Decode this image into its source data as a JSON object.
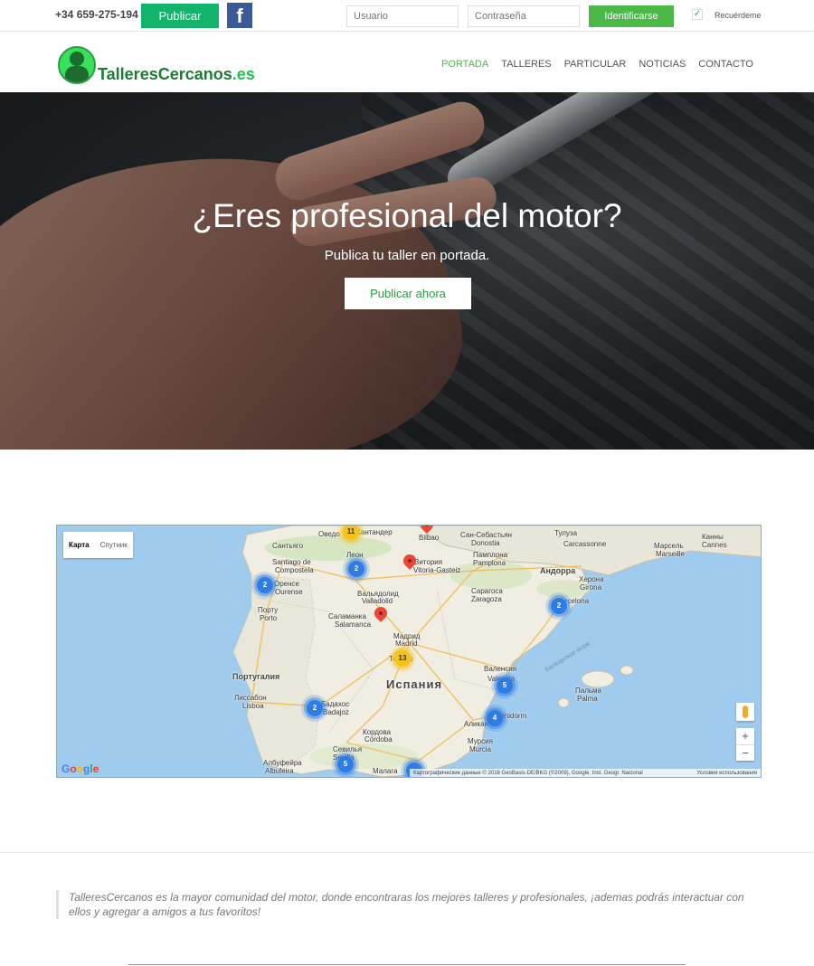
{
  "topbar": {
    "phone": "+34 659-275-194",
    "publish_label": "Publicar",
    "facebook_glyph": "f",
    "username_placeholder": "Usuario",
    "password_placeholder": "Contraseña",
    "login_label": "Identificarse",
    "remember_label": "Recuérdeme",
    "remember_checked": true
  },
  "brand": {
    "name_main": "TalleresCercanos",
    "name_domain": ".es",
    "color_primary": "#4cb848"
  },
  "nav": {
    "items": [
      {
        "label": "PORTADA",
        "active": true
      },
      {
        "label": "TALLERES",
        "active": false
      },
      {
        "label": "PARTICULAR",
        "active": false
      },
      {
        "label": "NOTICIAS",
        "active": false
      },
      {
        "label": "CONTACTO",
        "active": false
      }
    ]
  },
  "hero": {
    "title": "¿Eres profesional del motor?",
    "subtitle": "Publica tu taller en portada.",
    "cta_label": "Publicar ahora"
  },
  "map": {
    "type_map": "Карта",
    "type_satellite": "Спутник",
    "zoom_in": "+",
    "zoom_out": "−",
    "google_label": "Google",
    "attribution": "Картографические данные © 2016 GeoBasis-DE/BKG (©2009), Google, Inst. Geogr. Nacional",
    "terms": "Условия использования",
    "labels": {
      "spain": "Испания",
      "portugal": "Португалия",
      "andorra": "Андорра",
      "balearic_sea": "Балеарское море",
      "oviedo": "Оведо",
      "santander": "Сантандер",
      "bilbao": "Bilbao",
      "san_sebastian": "Сан-Себастьян",
      "donostia": "Donostia",
      "santiago": "Сантьяго",
      "santiago2": "Santiago de",
      "compostela": "Compostela",
      "leon": "Леон",
      "vitoria": "Витория",
      "vitoria2": "Vitoria-Gasteiz",
      "pamplona": "Памплона",
      "pamplona2": "Pamplona",
      "toulouse": "Тулуза",
      "carcassonne": "Каркасон",
      "carcassonne2": "Carcassonne",
      "marseille": "Марсель",
      "marseille2": "Marseille",
      "cannes": "Канны",
      "cannes2": "Cannes",
      "orense": "Оренсе",
      "ourense": "Ourense",
      "valladolid": "Вальядолид",
      "valladolid2": "Valladolid",
      "zaragoza": "Сарагоса",
      "zaragoza2": "Zaragoza",
      "girona": "Херона",
      "girona2": "Girona",
      "barcelona": "Barcelona",
      "porto": "Порту",
      "porto2": "Porto",
      "salamanca": "Саламанка",
      "salamanca2": "Salamanca",
      "madrid": "Мадрид",
      "madrid2": "Madrid",
      "toledo": "Толедо",
      "valencia": "Валенсия",
      "valencia2": "Valencia",
      "lisbon": "Лиссабон",
      "lisboa": "Lisboa",
      "badajoz": "Бадахос",
      "badajoz2": "Badajoz",
      "palma": "Пальма",
      "palma2": "Palma",
      "alicante": "Аликанте",
      "benidorm": "Benidorm",
      "cordoba": "Кордова",
      "cordoba2": "Córdoba",
      "murcia": "Мурсия",
      "murcia2": "Murcia",
      "sevilla": "Севилья",
      "sevilla2": "Sevilla",
      "albufeira": "Албуфейра",
      "albufeira2": "Albufeira",
      "malaga": "Малага"
    },
    "clusters": [
      {
        "count": "11",
        "color": "yellow"
      },
      {
        "count": "2",
        "color": "blue"
      },
      {
        "count": "2",
        "color": "blue"
      },
      {
        "count": "2",
        "color": "blue"
      },
      {
        "count": "13",
        "color": "yellow"
      },
      {
        "count": "2",
        "color": "blue"
      },
      {
        "count": "5",
        "color": "blue"
      },
      {
        "count": "4",
        "color": "blue"
      },
      {
        "count": "5",
        "color": "blue"
      }
    ]
  },
  "about": {
    "text": "TalleresCercanos es la mayor comunidad del motor, donde encontraras los mejores talleres y profesionales, ¡ademas podrás interactuar con ellos y agregar a amigos a tus favoritos!"
  }
}
